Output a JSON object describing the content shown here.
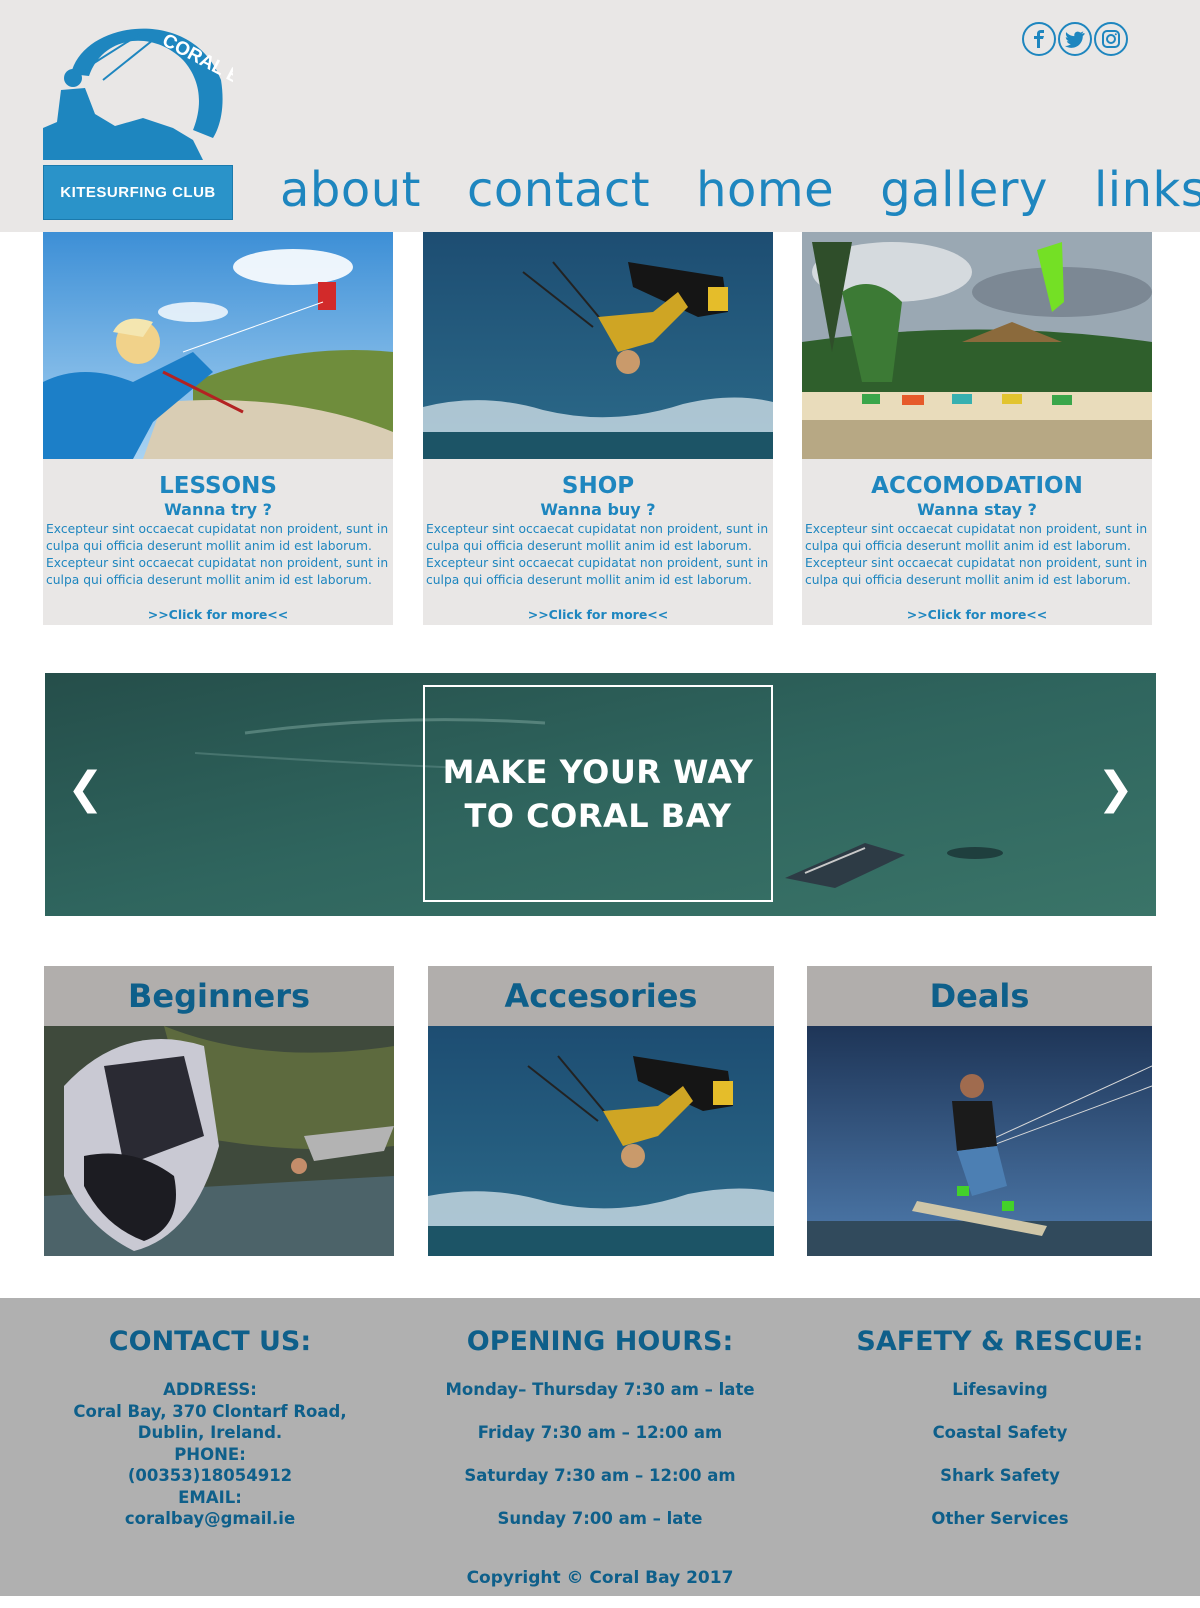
{
  "header": {
    "logo": {
      "arc_text": "CORAL BAY",
      "band_text": "KITESURFING CLUB"
    },
    "social": [
      "facebook-icon",
      "twitter-icon",
      "instagram-icon"
    ],
    "nav": [
      "about",
      "contact",
      "home",
      "gallery",
      "links"
    ]
  },
  "cards": [
    {
      "title": "LESSONS",
      "subtitle": "Wanna try ?",
      "text": "Excepteur sint occaecat cupidatat non proident, sunt in culpa qui officia deserunt mollit anim id est laborum. Excepteur sint occaecat cupidatat non proident, sunt in culpa qui officia deserunt mollit anim id est laborum.",
      "more": ">>Click for more<<"
    },
    {
      "title": "SHOP",
      "subtitle": "Wanna buy ?",
      "text": "Excepteur sint occaecat cupidatat non proident, sunt in culpa qui officia deserunt mollit anim id est laborum. Excepteur sint occaecat cupidatat non proident, sunt in culpa qui officia deserunt mollit anim id est laborum.",
      "more": ">>Click for more<<"
    },
    {
      "title": "ACCOMODATION",
      "subtitle": "Wanna stay ?",
      "text": "Excepteur sint occaecat cupidatat non proident, sunt in culpa qui officia deserunt mollit anim id est laborum. Excepteur sint occaecat cupidatat non proident, sunt in culpa qui officia deserunt mollit anim id est laborum.",
      "more": ">>Click for more<<"
    }
  ],
  "banner": {
    "line1": "MAKE YOUR WAY",
    "line2": "TO CORAL BAY",
    "prev": "❮",
    "next": "❯"
  },
  "tiles": [
    "Beginners",
    "Accesories",
    "Deals"
  ],
  "footer": {
    "contact": {
      "heading": "CONTACT US:",
      "address_label": "ADDRESS:",
      "address_line1": "Coral Bay, 370 Clontarf Road,",
      "address_line2": "Dublin, Ireland.",
      "phone_label": "PHONE:",
      "phone": "(00353)18054912",
      "email_label": "EMAIL:",
      "email": "coralbay@gmail.ie"
    },
    "hours": {
      "heading": "OPENING HOURS:",
      "lines": [
        "Monday– Thursday 7:30 am – late",
        "Friday 7:30 am – 12:00 am",
        "Saturday 7:30 am – 12:00 am",
        "Sunday 7:00 am – late"
      ]
    },
    "safety": {
      "heading": "SAFETY & RESCUE:",
      "links": [
        "Lifesaving",
        "Coastal Safety",
        "Shark Safety",
        "Other Services"
      ]
    },
    "copyright": "Copyright © Coral Bay  2017"
  },
  "colors": {
    "brand_blue": "#1e86bf",
    "dark_blue": "#0e5f8a",
    "header_bg": "#e9e7e6",
    "footer_bg": "#b0b0b0"
  }
}
